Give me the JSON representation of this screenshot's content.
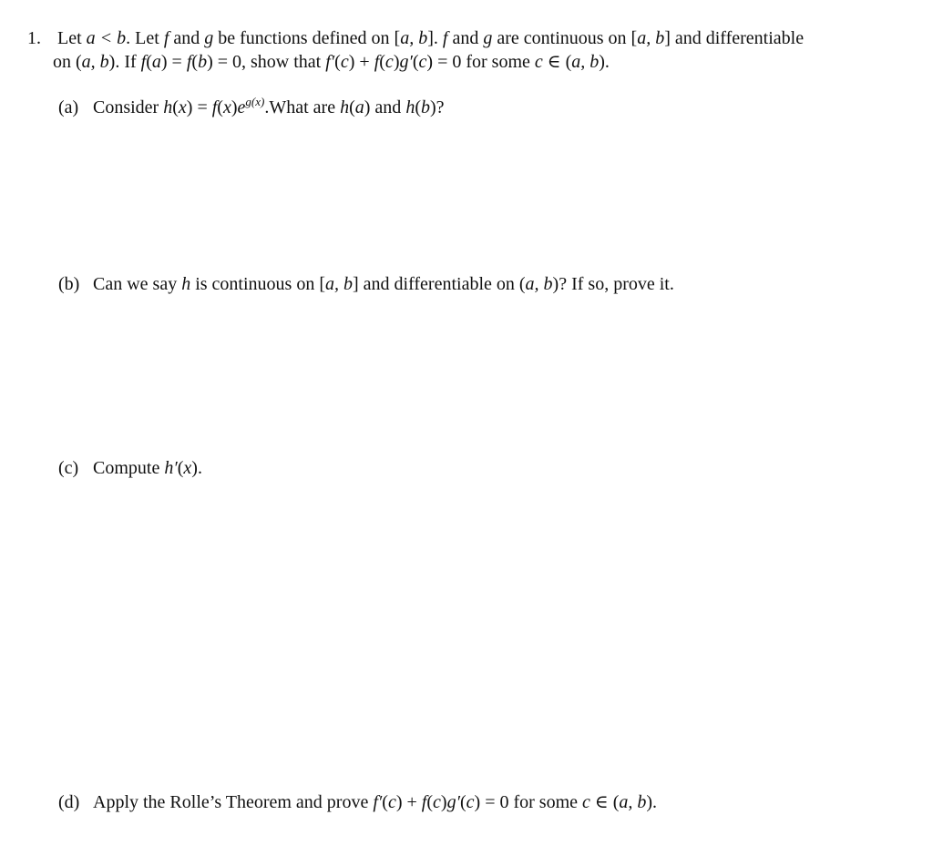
{
  "problem": {
    "number": "1.",
    "statement_line1": {
      "p1": "Let ",
      "m1": "a < b",
      "p2": ". Let ",
      "m2": "f",
      "p3": " and ",
      "m3": "g",
      "p4": " be functions defined on [",
      "m4": "a, b",
      "p5": "]. ",
      "m5": "f",
      "p6": " and ",
      "m6": "g",
      "p7": " are continuous on [",
      "m7": "a, b",
      "p8": "] and differentiable"
    },
    "statement_line2": {
      "p1": "on (",
      "m1": "a, b",
      "p2": "). If ",
      "m2": "f",
      "p3": "(",
      "m3": "a",
      "p4": ") = ",
      "m4": "f",
      "p5": "(",
      "m5": "b",
      "p6": ") = 0, show that ",
      "m6": "f′",
      "p7": "(",
      "m7": "c",
      "p8": ") + ",
      "m8": "f",
      "p9": "(",
      "m9": "c",
      "p10": ")",
      "m10": "g′",
      "p11": "(",
      "m11": "c",
      "p12": ") = 0 for some ",
      "m12": "c",
      "p13": " ∈ (",
      "m13": "a, b",
      "p14": ")."
    }
  },
  "parts": {
    "a": {
      "label": "(a)",
      "t1": "Consider ",
      "m1": "h",
      "t2": "(",
      "m2": "x",
      "t3": ") = ",
      "m3": "f",
      "t4": "(",
      "m4": "x",
      "t5": ")",
      "m5": "e",
      "sup": "g(x)",
      "t6": ".What are ",
      "m6": "h",
      "t7": "(",
      "m7": "a",
      "t8": ") and ",
      "m8": "h",
      "t9": "(",
      "m9": "b",
      "t10": ")?"
    },
    "b": {
      "label": "(b)",
      "t1": "Can we say ",
      "m1": "h",
      "t2": " is continuous on [",
      "m2": "a, b",
      "t3": "] and differentiable on (",
      "m3": "a, b",
      "t4": ")? If so, prove it."
    },
    "c": {
      "label": "(c)",
      "t1": "Compute ",
      "m1": "h′",
      "t2": "(",
      "m2": "x",
      "t3": ")."
    },
    "d": {
      "label": "(d)",
      "t1": "Apply the Rolle’s Theorem and prove ",
      "m1": "f′",
      "t2": "(",
      "m2": "c",
      "t3": ") + ",
      "m3": "f",
      "t4": "(",
      "m4": "c",
      "t5": ")",
      "m5": "g′",
      "t6": "(",
      "m6": "c",
      "t7": ") = 0 for some ",
      "m7": "c",
      "t8": " ∈ (",
      "m8": "a, b",
      "t9": ")."
    }
  }
}
